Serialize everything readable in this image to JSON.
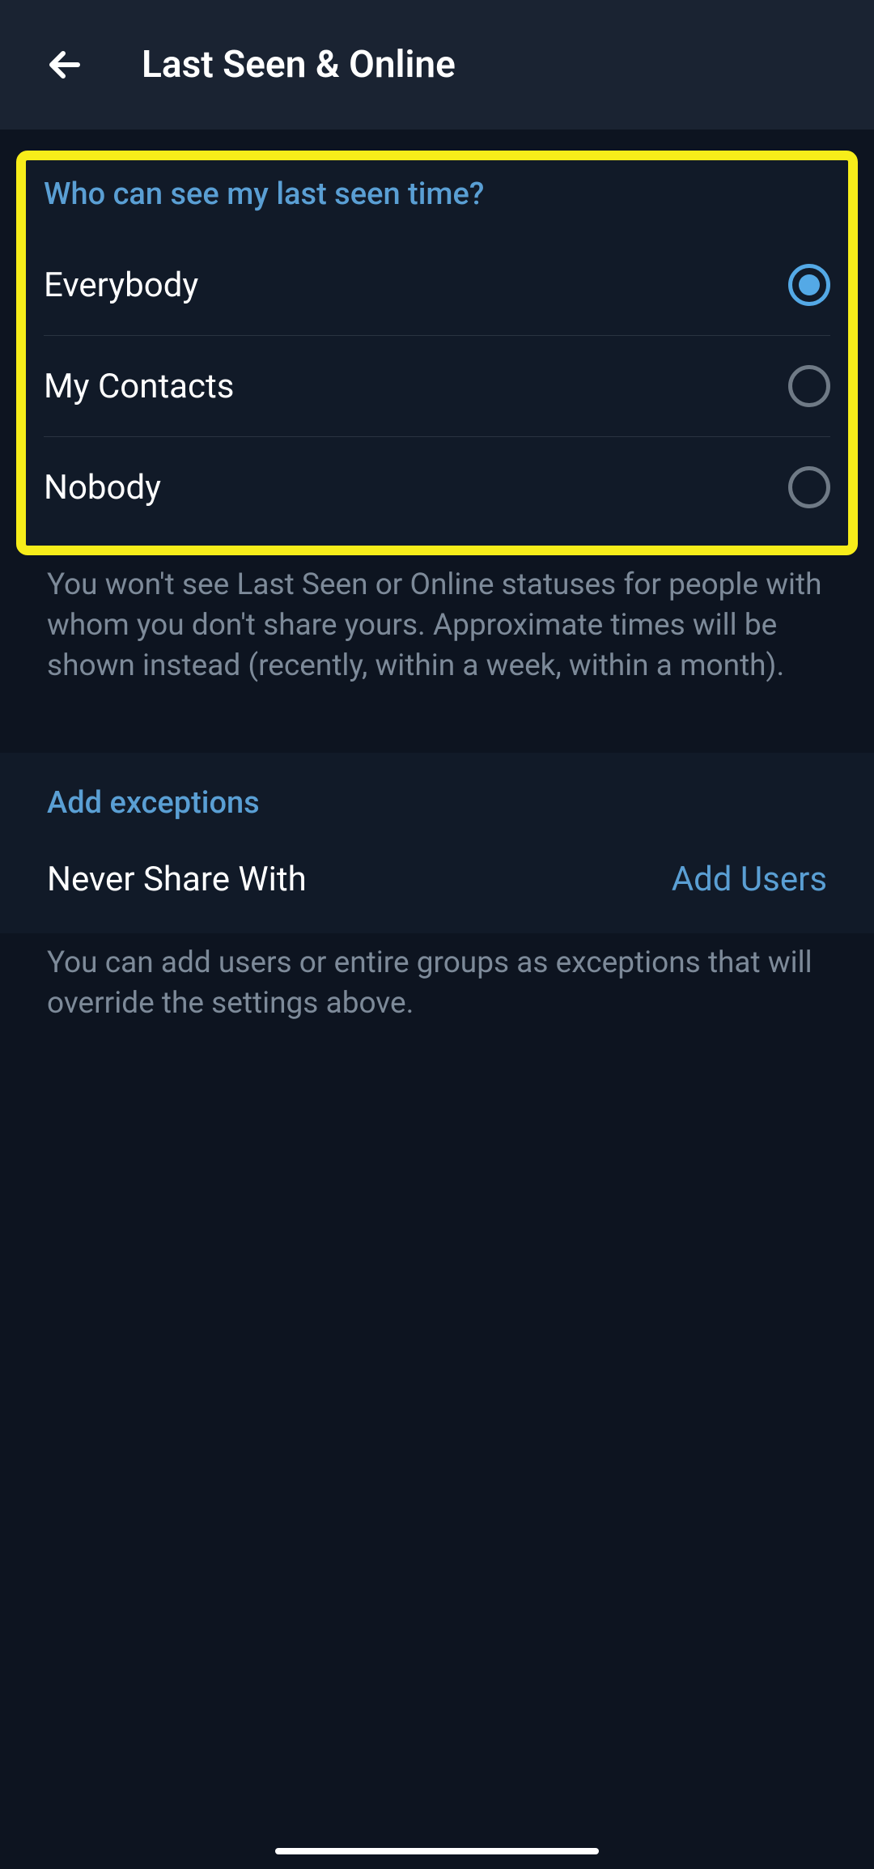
{
  "header": {
    "title": "Last Seen & Online"
  },
  "lastSeen": {
    "title": "Who can see my last seen time?",
    "options": [
      {
        "label": "Everybody",
        "selected": true
      },
      {
        "label": "My Contacts",
        "selected": false
      },
      {
        "label": "Nobody",
        "selected": false
      }
    ],
    "description": "You won't see Last Seen or Online statuses for people with whom you don't share yours. Approximate times will be shown instead (recently, within a week, within a month)."
  },
  "exceptions": {
    "title": "Add exceptions",
    "rowLabel": "Never Share With",
    "rowAction": "Add Users",
    "description": "You can add users or entire groups as exceptions that will override the settings above."
  }
}
